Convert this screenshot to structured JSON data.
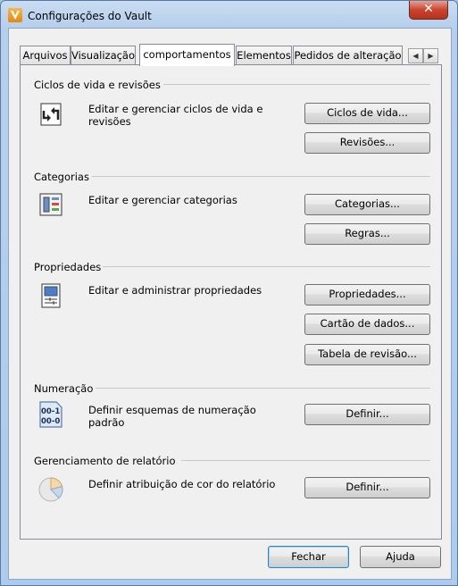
{
  "window": {
    "title": "Configurações do Vault",
    "close_glyph": "✕"
  },
  "tabs": [
    {
      "label": "Arquivos",
      "active": false
    },
    {
      "label": "Visualização",
      "active": false
    },
    {
      "label": "comportamentos",
      "active": true
    },
    {
      "label": "Elementos",
      "active": false
    },
    {
      "label": "Pedidos de alteração",
      "active": false
    }
  ],
  "tab_scroll": {
    "left": "◀",
    "right": "▶"
  },
  "groups": {
    "lifecycles": {
      "heading": "Ciclos de vida e revisões",
      "description": "Editar e gerenciar ciclos de vida e revisões",
      "buttons": [
        "Ciclos de vida...",
        "Revisões..."
      ],
      "icon": "lifecycle-icon"
    },
    "categories": {
      "heading": "Categorias",
      "description": "Editar e gerenciar categorias",
      "buttons": [
        "Categorias...",
        "Regras..."
      ],
      "icon": "categories-icon"
    },
    "properties": {
      "heading": "Propriedades",
      "description": "Editar e administrar propriedades",
      "buttons": [
        "Propriedades...",
        "Cartão de dados...",
        "Tabela de revisão..."
      ],
      "icon": "properties-icon"
    },
    "numbering": {
      "heading": "Numeração",
      "description": "Definir esquemas de numeração padrão",
      "buttons": [
        "Definir..."
      ],
      "icon": "numbering-icon",
      "icon_text": [
        "00-1",
        "00-0"
      ]
    },
    "reports": {
      "heading": "Gerenciamento de relatório",
      "description": "Definir atribuição de cor do relatório",
      "buttons": [
        "Definir..."
      ],
      "icon": "pie-chart-icon"
    }
  },
  "footer": {
    "close_label": "Fechar",
    "help_label": "Ajuda"
  }
}
